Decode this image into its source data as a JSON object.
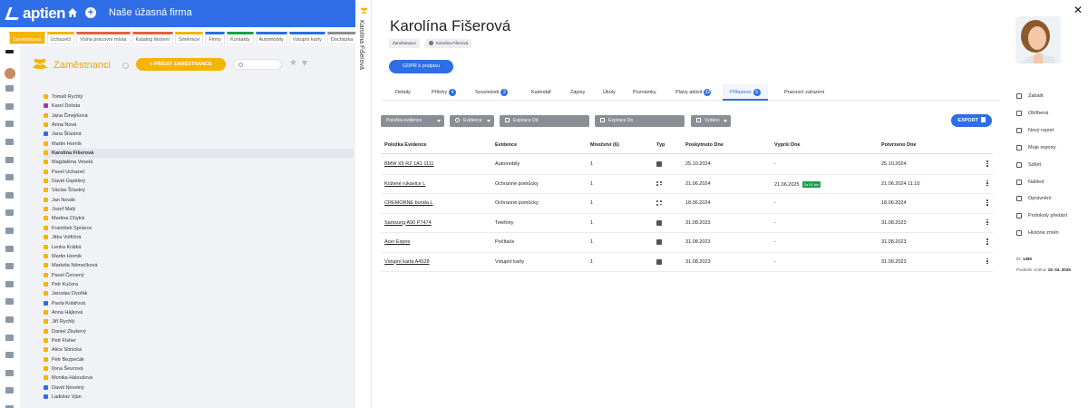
{
  "app": {
    "logo": "aptien",
    "company": "Naše úžasná firma"
  },
  "module_tabs": [
    {
      "label": "Zaměstnanci",
      "color": "#f5b400",
      "active": true
    },
    {
      "label": "Uchazeči",
      "color": "#f5b400"
    },
    {
      "label": "Volná pracovní místa",
      "color": "#e8603c"
    },
    {
      "label": "Katalog školení",
      "color": "#e8603c"
    },
    {
      "label": "Směrnice",
      "color": "#f5b400"
    },
    {
      "label": "Firmy",
      "color": "#2f6ee6"
    },
    {
      "label": "Kontakty",
      "color": "#1e9e4a"
    },
    {
      "label": "Automobily",
      "color": "#2f6ee6"
    },
    {
      "label": "Vstupní karty",
      "color": "#2f6ee6"
    },
    {
      "label": "Docházka",
      "color": "#8a8f95"
    }
  ],
  "employees_panel": {
    "title": "Zaměstnanci",
    "add_button": "+ PŘIDAT ZAMĚSTNANCE",
    "search_placeholder": "",
    "employees": [
      {
        "name": "Tomáš Rychlý",
        "color": "#f5b400"
      },
      {
        "name": "Karel Dolista",
        "color": "#8e44ad"
      },
      {
        "name": "Jana Čmejrková",
        "color": "#f5b400"
      },
      {
        "name": "Anna Nová",
        "color": "#f5b400"
      },
      {
        "name": "Jana Šťastná",
        "color": "#2f6ee6"
      },
      {
        "name": "Martin Horník",
        "color": "#f5b400"
      },
      {
        "name": "Karolína Fišerová",
        "color": "#f5b400",
        "selected": true
      },
      {
        "name": "Magdaléna Veselá",
        "color": "#f5b400"
      },
      {
        "name": "Pavel Uchazeč",
        "color": "#f5b400"
      },
      {
        "name": "David Úspěšný",
        "color": "#f5b400"
      },
      {
        "name": "Václav Šťastný",
        "color": "#f5b400"
      },
      {
        "name": "Jan Novák",
        "color": "#f5b400"
      },
      {
        "name": "Jozef Malý",
        "color": "#f5b400"
      },
      {
        "name": "Martina Chytrá",
        "color": "#f5b400"
      },
      {
        "name": "František Správce",
        "color": "#f5b400"
      },
      {
        "name": "Jitka Volfíčná",
        "color": "#f5b400"
      },
      {
        "name": "Lenka Krátká",
        "color": "#f5b400"
      },
      {
        "name": "Martin Horník",
        "color": "#f5b400"
      },
      {
        "name": "Markéta Němečková",
        "color": "#f5b400"
      },
      {
        "name": "Pavel Červený",
        "color": "#f5b400"
      },
      {
        "name": "Petr Kučera",
        "color": "#f5b400"
      },
      {
        "name": "Jaroslav Dvořák",
        "color": "#f5b400"
      },
      {
        "name": "Pavla Kolářová",
        "color": "#2f6ee6"
      },
      {
        "name": "Anna Hájková",
        "color": "#f5b400"
      },
      {
        "name": "Jiří Rychlý",
        "color": "#f5b400"
      },
      {
        "name": "Daniel Zkušený",
        "color": "#f5b400"
      },
      {
        "name": "Petr Fisher",
        "color": "#f5b400"
      },
      {
        "name": "Alice Sonická",
        "color": "#f5b400"
      },
      {
        "name": "Petr Bezpečák",
        "color": "#f5b400"
      },
      {
        "name": "Ilona Ševcová",
        "color": "#f5b400"
      },
      {
        "name": "Monika Haloušová",
        "color": "#f5b400"
      },
      {
        "name": "David Novotný",
        "color": "#2f6ee6"
      },
      {
        "name": "Ladislav Vjan",
        "color": "#2f6ee6"
      }
    ]
  },
  "vertical_tab": {
    "label": "Karolína Fišerová"
  },
  "detail": {
    "name": "Karolína Fišerová",
    "chips": [
      "Zaměstnanci",
      "Karolína Fišerová"
    ],
    "gdpr_button": "GDPR k podpisu",
    "tabs": [
      {
        "label": "Detaily"
      },
      {
        "label": "Přílohy",
        "badge": "4"
      },
      {
        "label": "Souvislosti",
        "badge": "3"
      },
      {
        "label": "Kalendář"
      },
      {
        "label": "Zápisy"
      },
      {
        "label": "Úkoly"
      },
      {
        "label": "Poznámky"
      },
      {
        "label": "Plány aktivit",
        "badge": "32"
      },
      {
        "label": "Přiřazeno",
        "badge": "6",
        "active": true
      },
      {
        "label": "Pracovní zařazení"
      }
    ],
    "filters": {
      "item_evidence": "Položka evidence",
      "evidence": "Evidence",
      "expiry_from": "Expirace Od",
      "expiry_to": "Expirace Do",
      "issued": "Vydáno"
    },
    "export_button": "EXPORT",
    "table": {
      "headers": [
        "Položka Evidence",
        "Evidence",
        "Množství (6)",
        "Typ",
        "Poskytnuto Dne",
        "Vyprší Dne",
        "Potvrzeno Dne"
      ],
      "rows": [
        {
          "item": "BMW X5 RZ 1A1 1111",
          "evidence": "Automobily",
          "qty": "1",
          "type": "single",
          "provided": "25.10.2024",
          "expires": "-",
          "late": "",
          "confirmed": "25.10.2024"
        },
        {
          "item": "Kožené rukavice L",
          "evidence": "Ochranné pomůcky",
          "qty": "1",
          "type": "grid",
          "provided": "21.06.2024",
          "expires": "21.06.2025",
          "late": "Za 92 dní",
          "confirmed": "21.06.2024 11:10"
        },
        {
          "item": "CREMORNE bunda L",
          "evidence": "Ochranné pomůcky",
          "qty": "1",
          "type": "grid",
          "provided": "18.06.2024",
          "expires": "-",
          "late": "",
          "confirmed": "18.06.2024"
        },
        {
          "item": "Samsung A90 P7474",
          "evidence": "Telefony",
          "qty": "1",
          "type": "single",
          "provided": "31.08.2023",
          "expires": "-",
          "late": "",
          "confirmed": "31.08.2023"
        },
        {
          "item": "Acer Expire",
          "evidence": "Počítače",
          "qty": "1",
          "type": "single",
          "provided": "31.08.2023",
          "expires": "-",
          "late": "",
          "confirmed": "31.08.2023"
        },
        {
          "item": "Vstupní karta A4528",
          "evidence": "Vstupní karty",
          "qty": "1",
          "type": "single",
          "provided": "31.08.2023",
          "expires": "-",
          "late": "",
          "confirmed": "31.08.2023"
        }
      ]
    }
  },
  "actions": [
    {
      "label": "Zabalit",
      "icon": "collapse-icon"
    },
    {
      "label": "Oblíbená",
      "icon": "star-icon"
    },
    {
      "label": "Nový report",
      "icon": "report-icon"
    },
    {
      "label": "Moje reporty",
      "icon": "reports-icon"
    },
    {
      "label": "Sdílet",
      "icon": "share-icon"
    },
    {
      "label": "Náhled",
      "icon": "eye-icon"
    },
    {
      "label": "Oprávnění",
      "icon": "permissions-icon"
    },
    {
      "label": "Protokoly předání",
      "icon": "protocol-icon"
    },
    {
      "label": "Historie změn",
      "icon": "history-icon"
    }
  ],
  "meta": {
    "id_label": "ID:",
    "id_value": "1450",
    "changed_label": "Poslední změna:",
    "changed_value": "19. 04. 2025"
  },
  "colors": {
    "brand": "#2f6ee6",
    "accent": "#f5b400",
    "success": "#1e9e4a"
  }
}
